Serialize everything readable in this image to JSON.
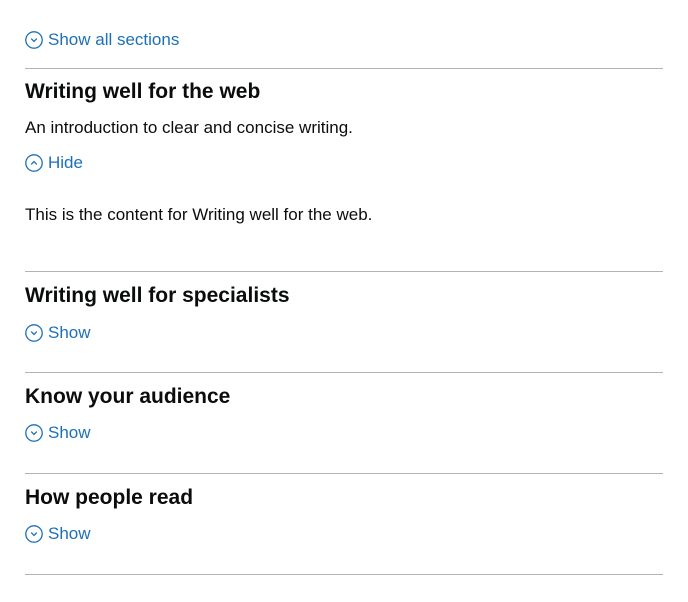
{
  "accordion": {
    "show_all_label": "Show all sections",
    "sections": [
      {
        "heading": "Writing well for the web",
        "summary": "An introduction to clear and concise writing.",
        "toggle_label": "Hide",
        "expanded": true,
        "content": "This is the content for Writing well for the web."
      },
      {
        "heading": "Writing well for specialists",
        "toggle_label": "Show",
        "expanded": false
      },
      {
        "heading": "Know your audience",
        "toggle_label": "Show",
        "expanded": false
      },
      {
        "heading": "How people read",
        "toggle_label": "Show",
        "expanded": false
      }
    ]
  },
  "colors": {
    "link": "#1d70b8",
    "text": "#0b0c0c",
    "border": "#b1b4b6"
  },
  "icons": {
    "show_all": "chevron-down-circle-icon",
    "hide": "chevron-up-circle-icon",
    "show": "chevron-down-circle-icon"
  }
}
